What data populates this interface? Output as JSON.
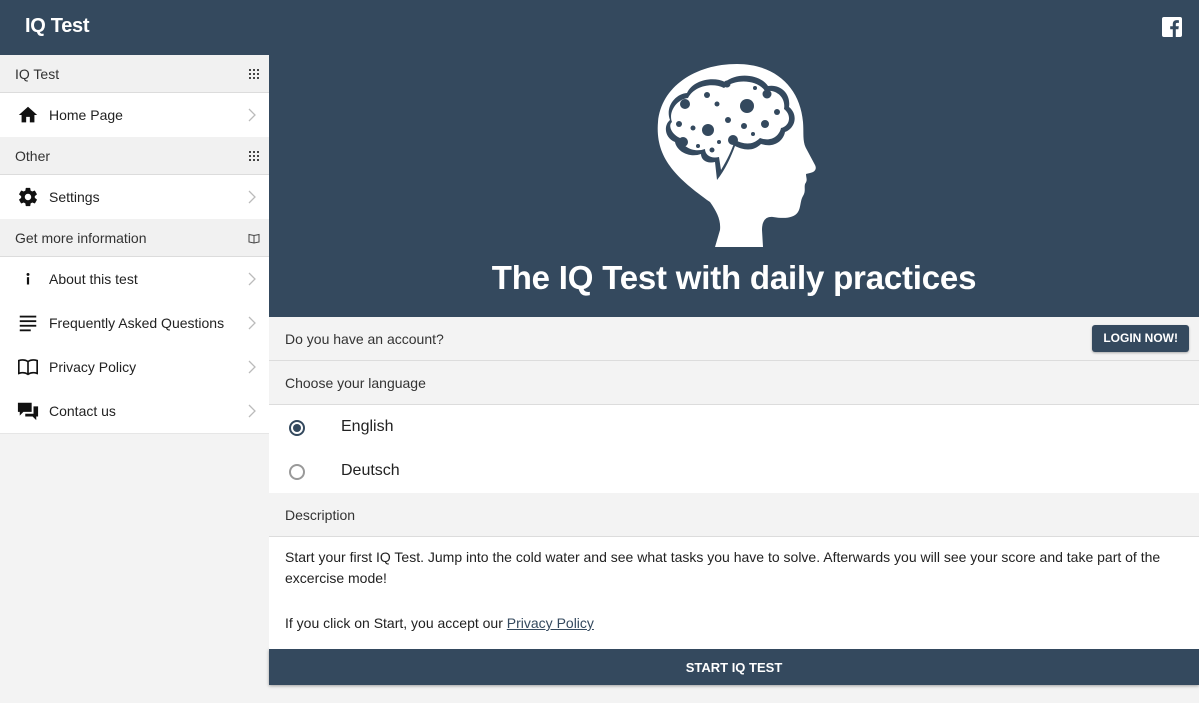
{
  "app": {
    "title": "IQ Test"
  },
  "sidebar": {
    "groups": [
      {
        "header": "IQ Test",
        "items": [
          {
            "label": "Home Page",
            "icon": "home-icon"
          }
        ]
      },
      {
        "header": "Other",
        "items": [
          {
            "label": "Settings",
            "icon": "gear-icon"
          }
        ]
      },
      {
        "header": "Get more information",
        "items": [
          {
            "label": "About this test",
            "icon": "info-icon"
          },
          {
            "label": "Frequently Asked Questions",
            "icon": "list-icon"
          },
          {
            "label": "Privacy Policy",
            "icon": "book-icon"
          },
          {
            "label": "Contact us",
            "icon": "chat-icon"
          }
        ]
      }
    ]
  },
  "hero": {
    "title": "The IQ Test with daily practices"
  },
  "account": {
    "question": "Do you have an account?",
    "login_label": "LOGIN NOW!"
  },
  "language": {
    "header": "Choose your language",
    "options": [
      "English",
      "Deutsch"
    ],
    "selected": "English"
  },
  "description": {
    "header": "Description",
    "text": "Start your first IQ Test. Jump into the cold water and see what tasks you have to solve. Afterwards you will see your score and take part of the excercise mode!",
    "accept_prefix": "If you click on Start, you accept our ",
    "privacy_link": "Privacy Policy"
  },
  "start_button": "START IQ TEST",
  "colors": {
    "primary": "#34495e",
    "background": "#f3f3f3"
  }
}
